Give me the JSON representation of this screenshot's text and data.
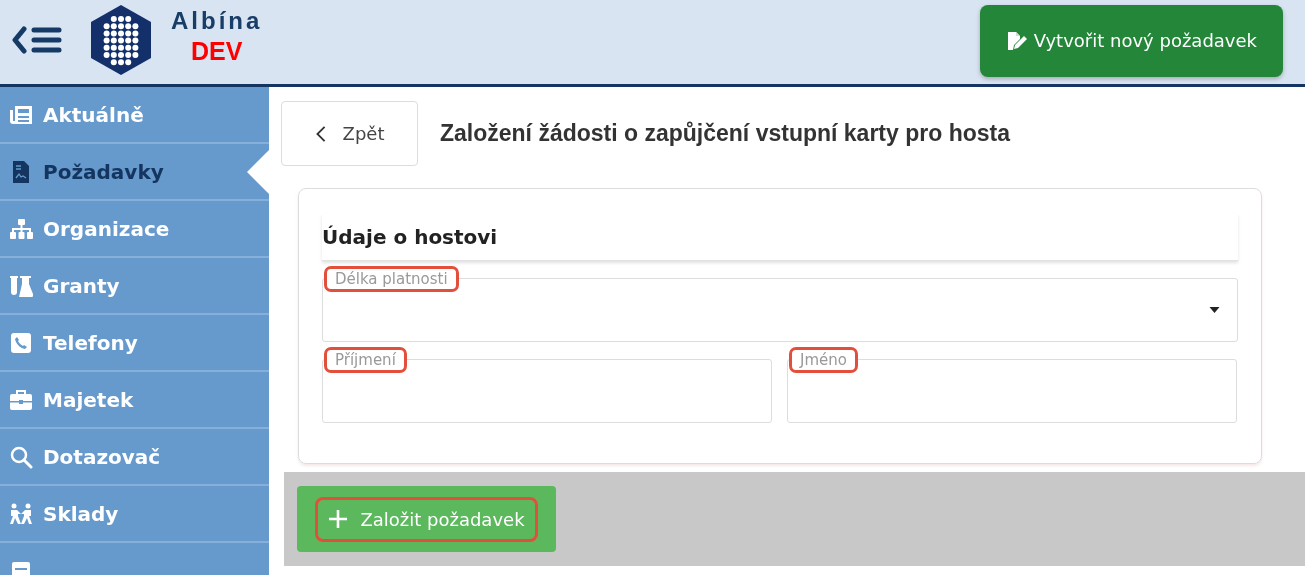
{
  "header": {
    "app_name": "Albína",
    "environment": "DEV",
    "new_request_button": "Vytvořit nový požadavek"
  },
  "sidebar": {
    "items": [
      {
        "label": "Aktuálně",
        "selected": false
      },
      {
        "label": "Požadavky",
        "selected": true
      },
      {
        "label": "Organizace",
        "selected": false
      },
      {
        "label": "Granty",
        "selected": false
      },
      {
        "label": "Telefony",
        "selected": false
      },
      {
        "label": "Majetek",
        "selected": false
      },
      {
        "label": "Dotazovač",
        "selected": false
      },
      {
        "label": "Sklady",
        "selected": false
      },
      {
        "selected": false
      }
    ]
  },
  "page": {
    "back_button": "Zpět",
    "title": "Založení žádosti o zapůjčení vstupní karty pro hosta"
  },
  "form": {
    "section_title": "Údaje o hostovi",
    "fields": [
      {
        "kind": "select",
        "label": "Délka platnosti",
        "highlighted": true
      },
      {
        "kind": "text",
        "label": "Příjmení",
        "highlighted": true
      },
      {
        "kind": "text",
        "label": "Jméno",
        "highlighted": true
      }
    ]
  },
  "footer": {
    "submit_button": {
      "label": "Založit požadavek",
      "highlighted": true
    }
  }
}
